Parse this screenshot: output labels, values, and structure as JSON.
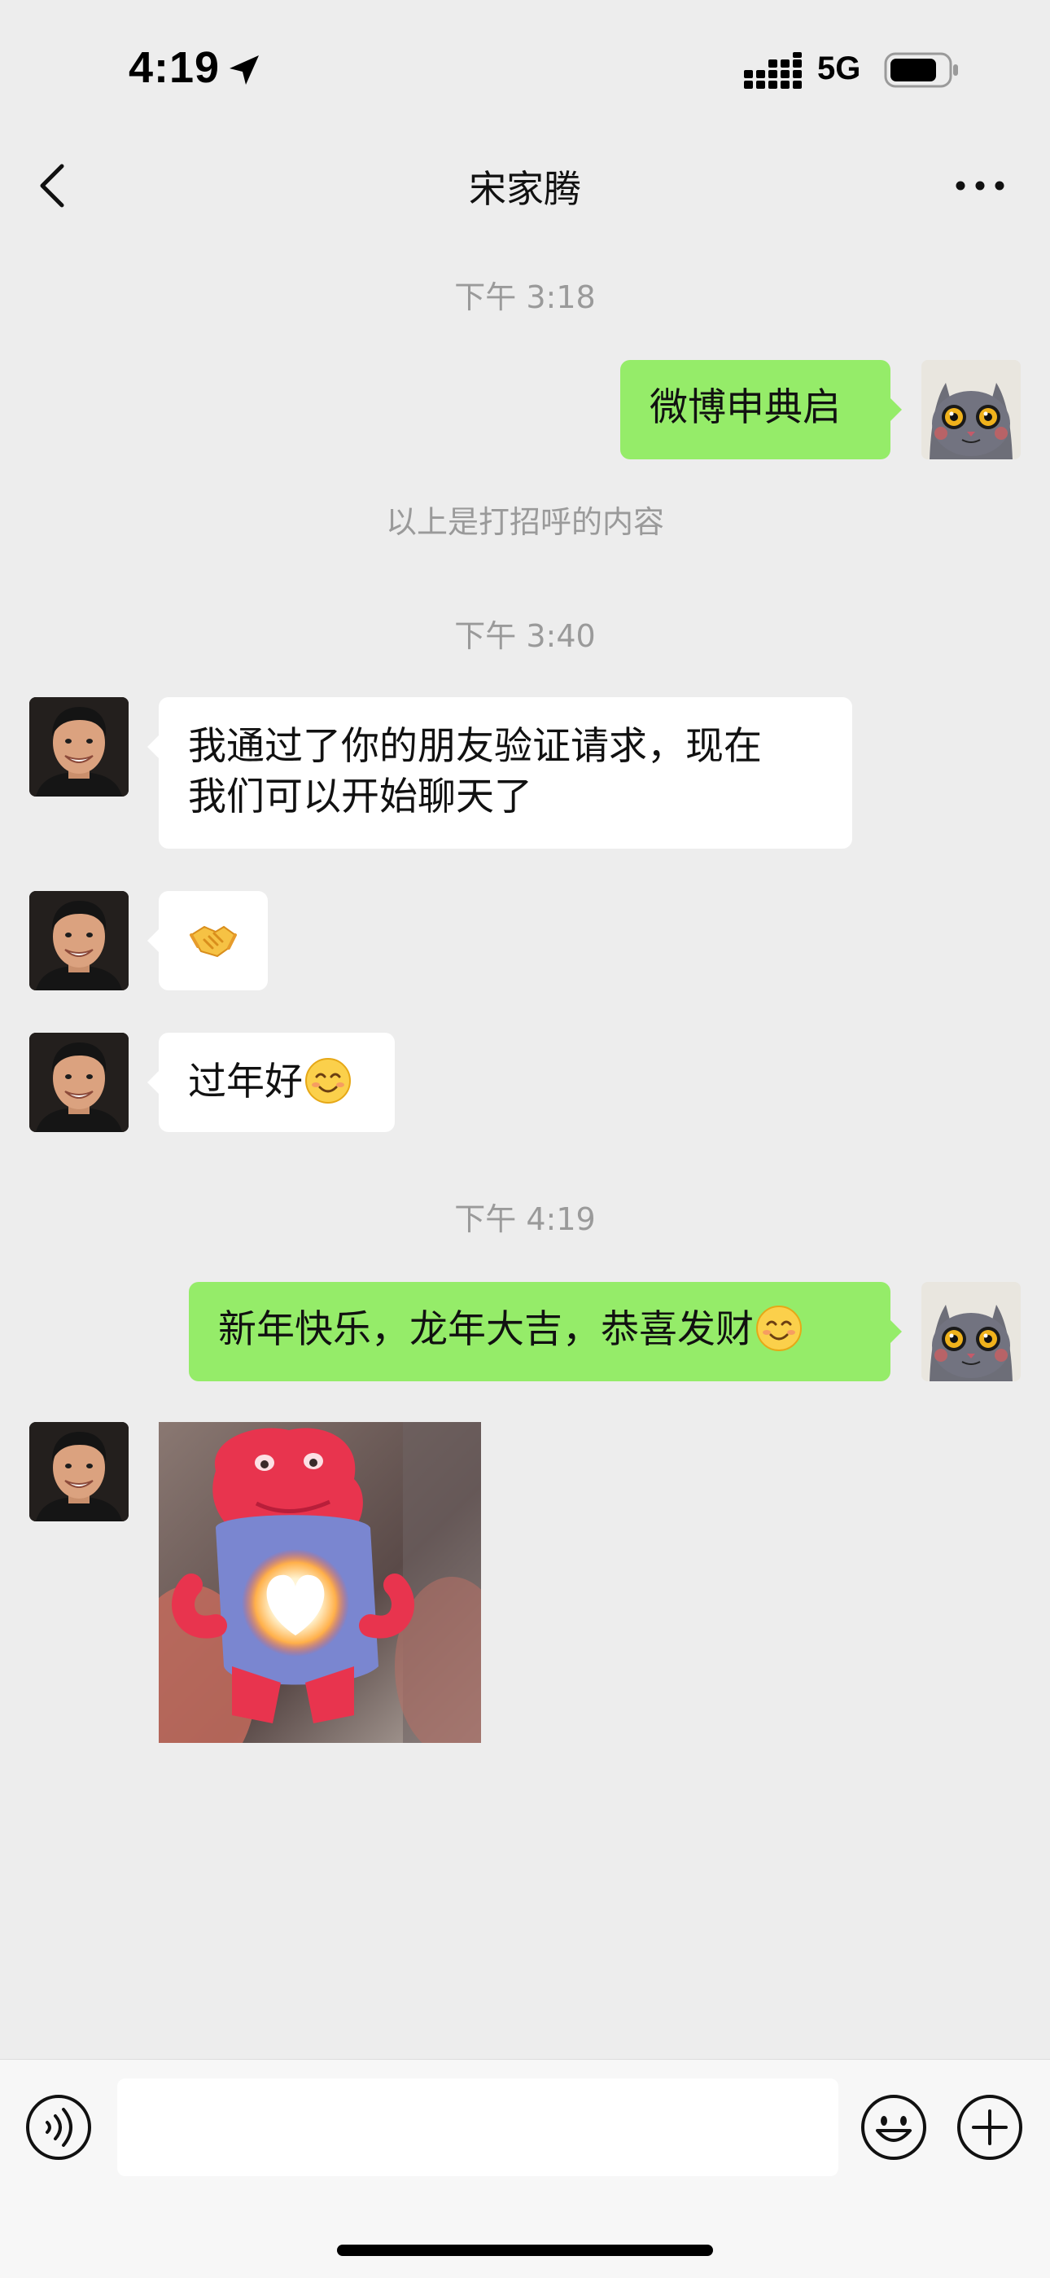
{
  "status_bar": {
    "time": "4:19",
    "network": "5G",
    "icons": [
      "location-arrow-icon",
      "signal-icon",
      "battery-icon"
    ]
  },
  "nav": {
    "title": "宋家腾",
    "back_icon": "chevron-left-icon",
    "more_icon": "ellipsis-icon"
  },
  "messages": {
    "time_1": "下午 3:18",
    "out_1": "微博申典启",
    "system_1": "以上是打招呼的内容",
    "time_2": "下午 3:40",
    "in_1_line_1": "我通过了你的朋友验证请求，现在",
    "in_1_line_2": "我们可以开始聊天了",
    "in_2_icon": "handshake-emoji",
    "in_3": "过年好",
    "in_3_icon": "smiling-face-emoji",
    "time_3": "下午 4:19",
    "out_2": "新年快乐，龙年大吉，恭喜发财",
    "out_2_icon": "smiling-face-emoji",
    "in_4_icon": "heart-glowing-toy-image"
  },
  "input": {
    "placeholder": "",
    "icons": [
      "voice-icon",
      "emoji-icon",
      "plus-icon"
    ]
  },
  "colors": {
    "background": "#ededed",
    "outgoing_bubble": "#95ec69",
    "incoming_bubble": "#ffffff",
    "timestamp_text": "#9a9a9a"
  }
}
